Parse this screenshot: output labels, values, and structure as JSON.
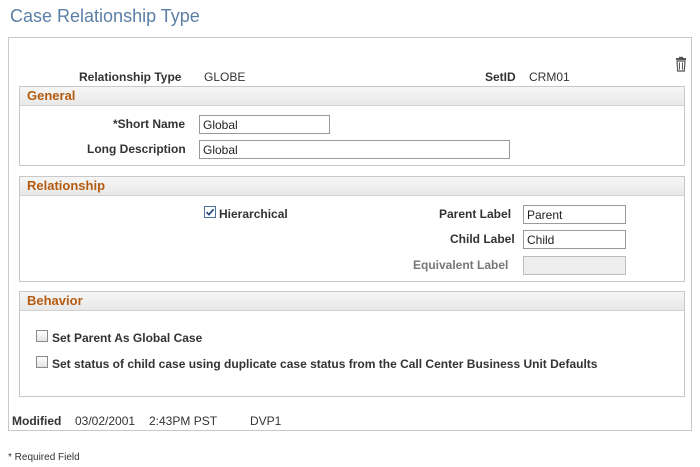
{
  "page": {
    "title": "Case Relationship Type"
  },
  "summary": {
    "relationship_type_label": "Relationship Type",
    "relationship_type_value": "GLOBE",
    "setid_label": "SetID",
    "setid_value": "CRM01"
  },
  "general": {
    "title": "General",
    "short_name_label": "*Short Name",
    "short_name_value": "Global",
    "long_description_label": "Long Description",
    "long_description_value": "Global"
  },
  "relationship": {
    "title": "Relationship",
    "hierarchical_label": "Hierarchical",
    "hierarchical_checked": true,
    "parent_label_label": "Parent Label",
    "parent_label_value": "Parent",
    "child_label_label": "Child Label",
    "child_label_value": "Child",
    "equivalent_label_label": "Equivalent Label",
    "equivalent_label_value": ""
  },
  "behavior": {
    "title": "Behavior",
    "set_parent_global_label": "Set Parent As Global Case",
    "set_parent_global_checked": false,
    "set_status_child_label": "Set status of child case using duplicate case status from the Call Center Business Unit Defaults",
    "set_status_child_checked": false
  },
  "modified": {
    "label": "Modified",
    "date": "03/02/2001",
    "time": "2:43PM PST",
    "user": "DVP1"
  },
  "footer": {
    "required_note": "* Required Field"
  },
  "icons": {
    "delete": "trash-icon",
    "check": "checkmark-icon"
  },
  "colors": {
    "title": "#5b7fa6",
    "group_title": "#b45b10",
    "border": "#c8c8c8"
  }
}
